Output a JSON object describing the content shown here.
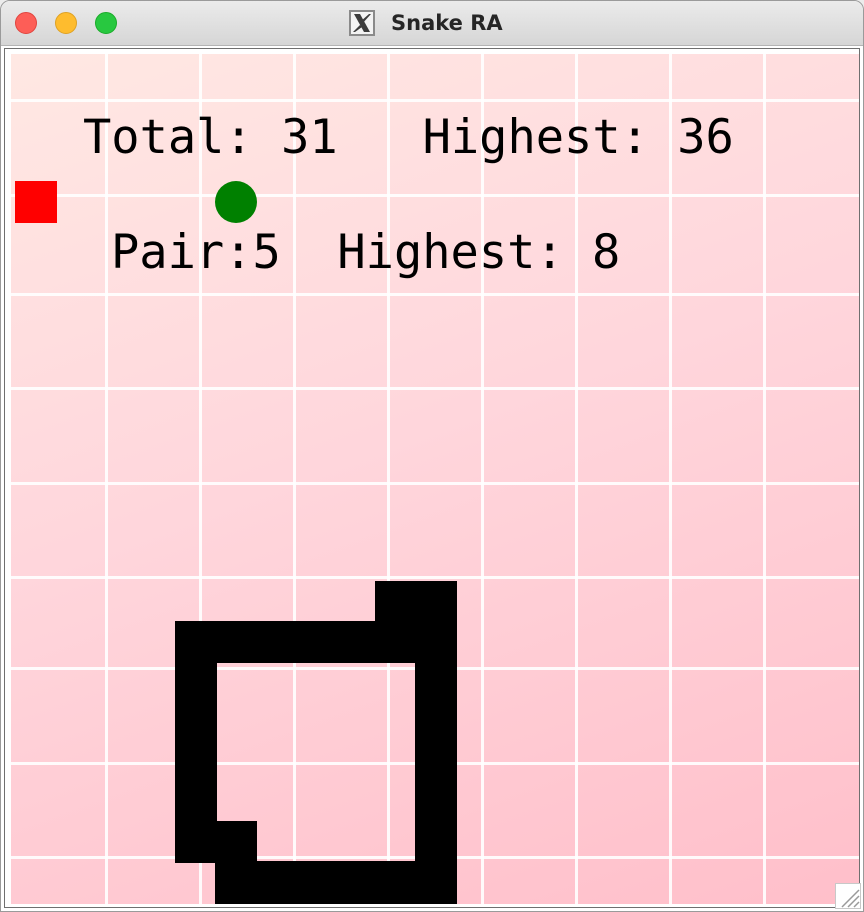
{
  "window": {
    "title": "Snake RA",
    "title_icon": "x11-icon",
    "controls": [
      "close",
      "minimize",
      "zoom"
    ]
  },
  "hud": {
    "total_label": "Total:",
    "total_value": "31",
    "total_highest_label": "Highest:",
    "total_highest_value": "36",
    "pair_label": "Pair:",
    "pair_value": "5",
    "pair_highest_label": "Highest:",
    "pair_highest_value": "8"
  },
  "board": {
    "grid_cols": 9,
    "grid_rows": 9,
    "snake_color": "#000000",
    "food_color": "#ff0000",
    "goal_color": "#008000"
  }
}
